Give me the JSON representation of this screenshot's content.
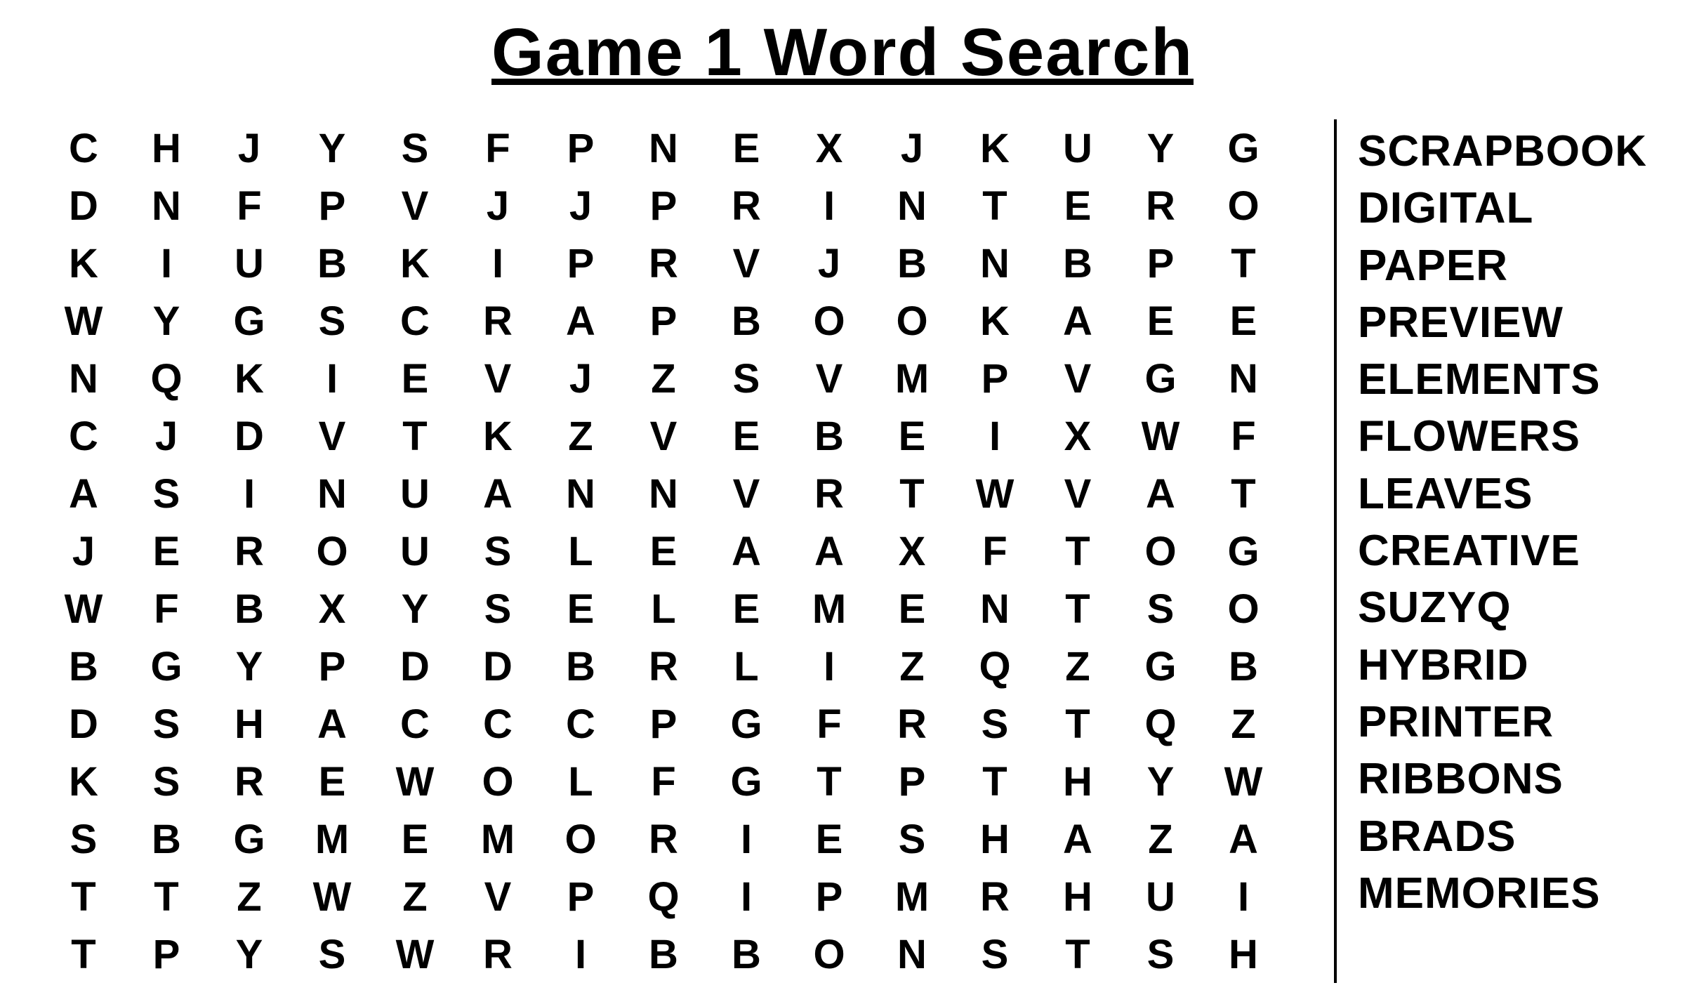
{
  "title": "Game 1 Word Search",
  "grid": [
    [
      "C",
      "H",
      "J",
      "Y",
      "S",
      "F",
      "P",
      "N",
      "E",
      "X",
      "J",
      "K",
      "U",
      "Y",
      "G"
    ],
    [
      "D",
      "N",
      "F",
      "P",
      "V",
      "J",
      "J",
      "P",
      "R",
      "I",
      "N",
      "T",
      "E",
      "R",
      "O"
    ],
    [
      "K",
      "I",
      "U",
      "B",
      "K",
      "I",
      "P",
      "R",
      "V",
      "J",
      "B",
      "N",
      "B",
      "P",
      "T"
    ],
    [
      "W",
      "Y",
      "G",
      "S",
      "C",
      "R",
      "A",
      "P",
      "B",
      "O",
      "O",
      "K",
      "A",
      "E",
      "E"
    ],
    [
      "N",
      "Q",
      "K",
      "I",
      "E",
      "V",
      "J",
      "Z",
      "S",
      "V",
      "M",
      "P",
      "V",
      "G",
      "N"
    ],
    [
      "C",
      "J",
      "D",
      "V",
      "T",
      "K",
      "Z",
      "V",
      "E",
      "B",
      "E",
      "I",
      "X",
      "W",
      "F"
    ],
    [
      "A",
      "S",
      "I",
      "N",
      "U",
      "A",
      "N",
      "N",
      "V",
      "R",
      "T",
      "W",
      "V",
      "A",
      "T"
    ],
    [
      "J",
      "E",
      "R",
      "O",
      "U",
      "S",
      "L",
      "E",
      "A",
      "A",
      "X",
      "F",
      "T",
      "O",
      "G"
    ],
    [
      "W",
      "F",
      "B",
      "X",
      "Y",
      "S",
      "E",
      "L",
      "E",
      "M",
      "E",
      "N",
      "T",
      "S",
      "O"
    ],
    [
      "B",
      "G",
      "Y",
      "P",
      "D",
      "D",
      "B",
      "R",
      "L",
      "I",
      "Z",
      "Q",
      "Z",
      "G",
      "B"
    ],
    [
      "D",
      "S",
      "H",
      "A",
      "C",
      "C",
      "C",
      "P",
      "G",
      "F",
      "R",
      "S",
      "T",
      "Q",
      "Z"
    ],
    [
      "K",
      "S",
      "R",
      "E",
      "W",
      "O",
      "L",
      "F",
      "G",
      "T",
      "P",
      "T",
      "H",
      "Y",
      "W"
    ],
    [
      "S",
      "B",
      "G",
      "M",
      "E",
      "M",
      "O",
      "R",
      "I",
      "E",
      "S",
      "H",
      "A",
      "Z",
      "A"
    ],
    [
      "T",
      "T",
      "Z",
      "W",
      "Z",
      "V",
      "P",
      "Q",
      "I",
      "P",
      "M",
      "R",
      "H",
      "U",
      "I"
    ],
    [
      "T",
      "P",
      "Y",
      "S",
      "W",
      "R",
      "I",
      "B",
      "B",
      "O",
      "N",
      "S",
      "T",
      "S",
      "H"
    ]
  ],
  "words": [
    "SCRAPBOOK",
    "DIGITAL",
    "PAPER",
    "PREVIEW",
    "ELEMENTS",
    "FLOWERS",
    "LEAVES",
    "CREATIVE",
    "SUZYQ",
    "HYBRID",
    "PRINTER",
    "RIBBONS",
    "BRADS",
    "MEMORIES"
  ]
}
